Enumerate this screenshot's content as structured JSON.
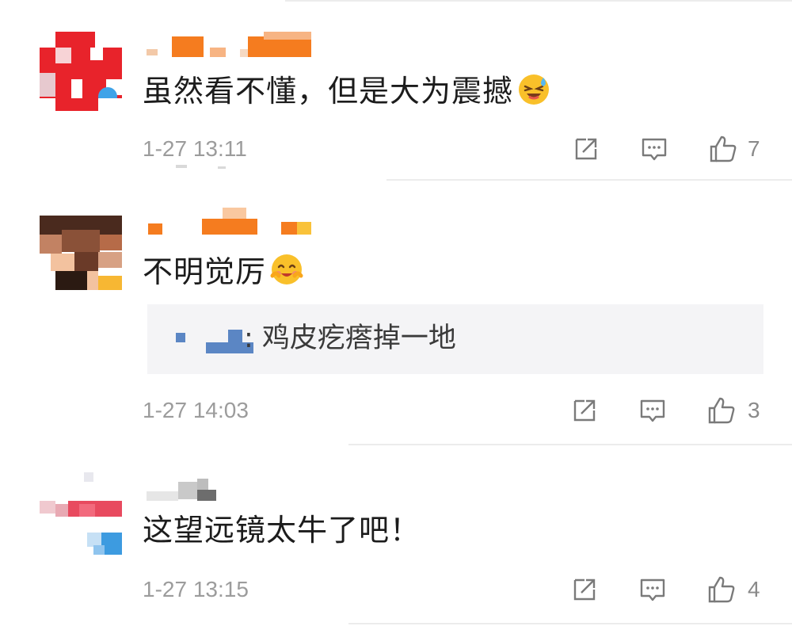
{
  "colors": {
    "text": "#1c1c1c",
    "meta": "#9c9c9c",
    "reply_bg": "#f4f4f6",
    "reply_name": "#5b86c4",
    "orange": "#f57c1f"
  },
  "comments": [
    {
      "text": "虽然看不懂，但是大为震撼",
      "emoji": "laughing-tears-emoji",
      "time": "1-27 13:11",
      "likes": "7",
      "icons": [
        "share-icon",
        "comment-icon",
        "thumbs-up-icon"
      ]
    },
    {
      "text": "不明觉厉",
      "emoji": "blushing-smile-emoji",
      "reply": {
        "text": ": 鸡皮疙瘩掉一地"
      },
      "time": "1-27 14:03",
      "likes": "3",
      "icons": [
        "share-icon",
        "comment-icon",
        "thumbs-up-icon"
      ]
    },
    {
      "text": "这望远镜太牛了吧！",
      "time": "1-27 13:15",
      "likes": "4",
      "icons": [
        "share-icon",
        "comment-icon",
        "thumbs-up-icon"
      ]
    }
  ]
}
